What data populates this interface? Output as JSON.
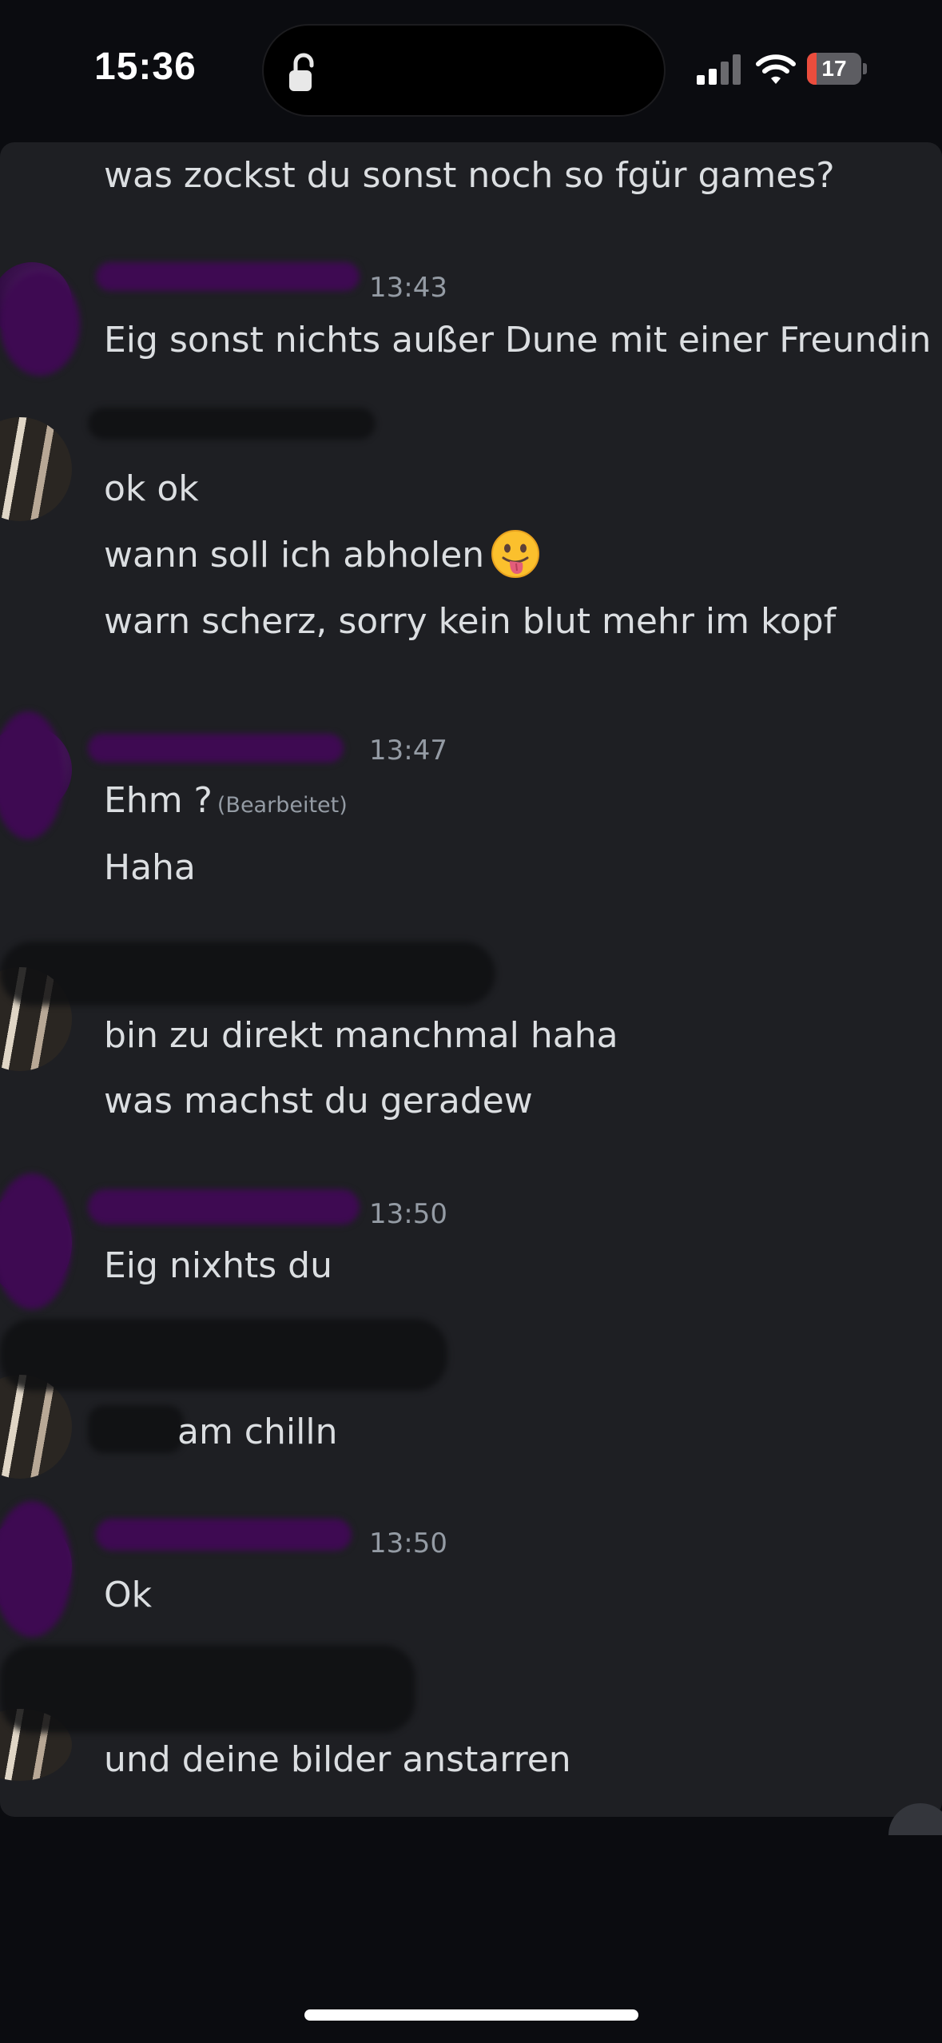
{
  "status_bar": {
    "time": "15:36",
    "battery_level": "17",
    "battery_fraction": 0.17,
    "icons": [
      "unlock-icon",
      "cellular-signal-icon",
      "wifi-icon",
      "battery-icon"
    ]
  },
  "messages": [
    {
      "text": "was zockst du sonst noch so fgür games?"
    },
    {
      "timestamp": "13:43",
      "text": "Eig sonst nichts außer Dune mit einer Freundin"
    },
    {
      "text": "ok ok"
    },
    {
      "text": "wann soll ich abholen",
      "emoji": "face-with-tongue-icon"
    },
    {
      "text": "warn scherz, sorry kein blut mehr im kopf"
    },
    {
      "timestamp": "13:47",
      "text": "Ehm ?",
      "edited": "(Bearbeitet)"
    },
    {
      "text": "Haha"
    },
    {
      "text": "bin zu direkt manchmal haha"
    },
    {
      "text": "was machst du geradew"
    },
    {
      "timestamp": "13:50",
      "text": "Eig nixhts du"
    },
    {
      "text": "am chilln"
    },
    {
      "timestamp": "13:50",
      "text": "Ok"
    },
    {
      "text": "und deine bilder anstarren"
    }
  ],
  "colors": {
    "background": "#0b0c10",
    "panel": "#1e1f23",
    "message_text": "#dbdee1",
    "muted_text": "#949ba4",
    "redaction_purple": "#3e0a52",
    "battery_red": "#eb4d3d"
  }
}
